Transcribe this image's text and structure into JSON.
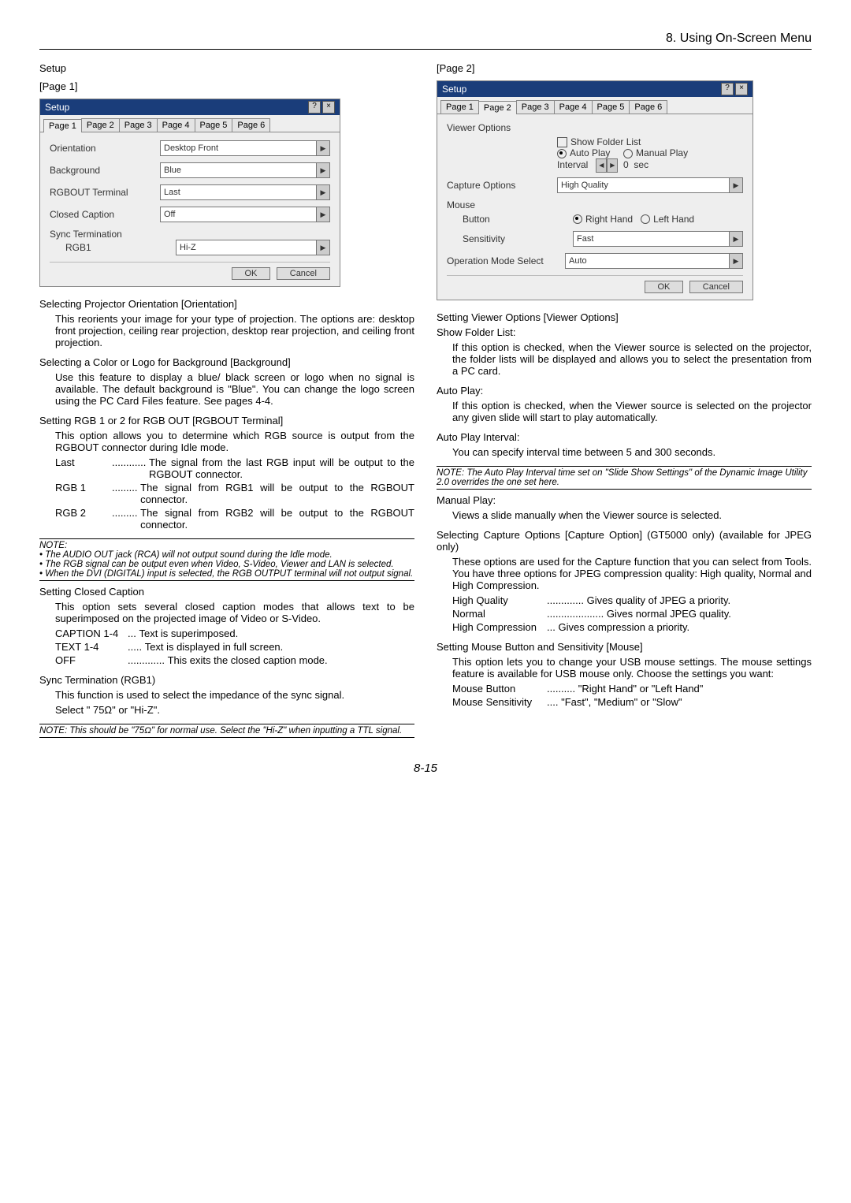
{
  "header": {
    "chapter": "8. Using On-Screen Menu"
  },
  "page_number": "8-15",
  "left": {
    "title": "Setup",
    "page_label": "[Page 1]",
    "dialog": {
      "title": "Setup",
      "tabs": [
        "Page 1",
        "Page 2",
        "Page 3",
        "Page 4",
        "Page 5",
        "Page 6"
      ],
      "active_tab": 0,
      "fields": {
        "orientation_label": "Orientation",
        "orientation_value": "Desktop Front",
        "background_label": "Background",
        "background_value": "Blue",
        "rgbout_label": "RGBOUT Terminal",
        "rgbout_value": "Last",
        "caption_label": "Closed Caption",
        "caption_value": "Off",
        "sync_label": "Sync Termination",
        "sync_sub": "RGB1",
        "sync_value": "Hi-Z"
      },
      "ok": "OK",
      "cancel": "Cancel"
    },
    "orientation": {
      "head": "Selecting Projector Orientation [Orientation]",
      "body": "This reorients your image for your type of projection. The options are: desktop front projection, ceiling rear projection, desktop rear projection, and ceiling front projection."
    },
    "background": {
      "head": "Selecting a Color or Logo for Background [Background]",
      "body": "Use this feature to display a blue/ black screen or logo when no signal is available. The default background is \"Blue\". You can change the logo screen using the PC Card Files feature. See pages 4-4."
    },
    "rgbout": {
      "head": "Setting RGB 1 or 2 for RGB OUT [RGBOUT Terminal]",
      "body": "This option allows you to determine which RGB source is output from the RGBOUT connector during Idle mode.",
      "items": [
        {
          "term": "Last",
          "dots": "............",
          "def": "The signal from the last RGB input will be output to the RGBOUT connector."
        },
        {
          "term": "RGB 1",
          "dots": ".........",
          "def": "The signal from RGB1 will be output to the RGBOUT connector."
        },
        {
          "term": "RGB 2",
          "dots": ".........",
          "def": "The signal from RGB2 will be output to the RGBOUT connector."
        }
      ],
      "note_head": "NOTE:",
      "notes": [
        "• The AUDIO OUT jack (RCA) will not output sound during the Idle mode.",
        "• The RGB signal can be output even when Video, S-Video, Viewer and LAN is selected.",
        "• When the DVI (DIGITAL) input is selected, the RGB OUTPUT terminal will not output signal."
      ]
    },
    "cc": {
      "head": "Setting Closed Caption",
      "body": "This option sets several closed caption modes that allows text to be superimposed on the projected image of Video or S-Video.",
      "items": [
        {
          "term": "CAPTION 1-4",
          "dots": "...",
          "def": "Text is superimposed."
        },
        {
          "term": "TEXT 1-4",
          "dots": ".....",
          "def": "Text is displayed in full screen."
        },
        {
          "term": "OFF",
          "dots": ".............",
          "def": "This exits the closed caption mode."
        }
      ]
    },
    "sync": {
      "head": "Sync Termination (RGB1)",
      "body1": "This function is used to select the impedance of the sync signal.",
      "body2": "Select \" 75Ω\" or \"Hi-Z\".",
      "note": "NOTE: This should be \"75Ω\" for normal use. Select the \"Hi-Z\" when inputting a TTL signal."
    }
  },
  "right": {
    "page_label": "[Page 2]",
    "dialog": {
      "title": "Setup",
      "tabs": [
        "Page 1",
        "Page 2",
        "Page 3",
        "Page 4",
        "Page 5",
        "Page 6"
      ],
      "active_tab": 1,
      "viewer_label": "Viewer Options",
      "show_folder": "Show Folder List",
      "auto_play": "Auto Play",
      "manual_play": "Manual Play",
      "interval_label": "Interval",
      "interval_value": "0",
      "interval_unit": "sec",
      "capture_label": "Capture Options",
      "capture_value": "High Quality",
      "mouse_label": "Mouse",
      "button_label": "Button",
      "right_hand": "Right Hand",
      "left_hand": "Left Hand",
      "sensitivity_label": "Sensitivity",
      "sensitivity_value": "Fast",
      "opmode_label": "Operation Mode Select",
      "opmode_value": "Auto",
      "ok": "OK",
      "cancel": "Cancel"
    },
    "viewer": {
      "head": "Setting Viewer Options [Viewer Options]",
      "sfl_head": "Show Folder List:",
      "sfl_body": "If this option is checked, when the Viewer source is selected on the projector, the folder lists will be displayed and allows you to select the presentation from a PC card.",
      "ap_head": "Auto Play:",
      "ap_body": "If this option is checked, when the Viewer source is selected on the projector any given slide will start to play automatically.",
      "api_head": "Auto Play Interval:",
      "api_body": "You can specify interval time between 5 and 300 seconds.",
      "api_note": "NOTE: The Auto Play Interval time set on \"Slide Show Settings\" of the Dynamic Image Utility 2.0 overrides the one set here.",
      "mp_head": "Manual Play:",
      "mp_body": "Views a slide manually when the Viewer source is selected."
    },
    "capture": {
      "head": "Selecting Capture Options [Capture Option] (GT5000 only) (available for JPEG only)",
      "body": "These options are used for the Capture function that you can select from Tools. You have three options for JPEG compression quality: High quality, Normal and High Compression.",
      "items": [
        {
          "term": "High Quality",
          "dots": ".............",
          "def": "Gives quality of JPEG a priority."
        },
        {
          "term": "Normal",
          "dots": "....................",
          "def": "Gives normal JPEG quality."
        },
        {
          "term": "High Compression",
          "dots": "...",
          "def": "Gives compression a priority."
        }
      ]
    },
    "mouse": {
      "head": "Setting Mouse Button and Sensitivity [Mouse]",
      "body": "This option lets you to change your USB mouse settings. The mouse settings feature is available for USB mouse only. Choose the settings you want:",
      "items": [
        {
          "term": "Mouse Button",
          "dots": "..........",
          "def": "\"Right Hand\" or \"Left Hand\""
        },
        {
          "term": "Mouse Sensitivity",
          "dots": "....",
          "def": "\"Fast\", \"Medium\" or \"Slow\""
        }
      ]
    }
  }
}
